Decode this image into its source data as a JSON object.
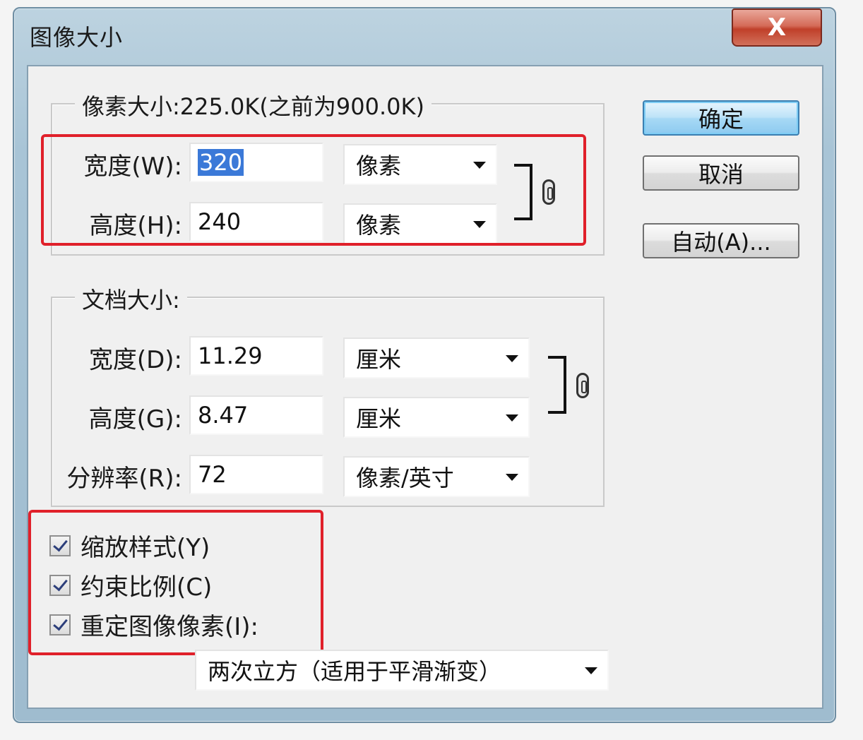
{
  "window": {
    "title": "图像大小",
    "close_glyph": "X"
  },
  "pixel_dimensions": {
    "legend": "像素大小:225.0K(之前为900.0K)",
    "width_label": "宽度(W):",
    "width_value": "320",
    "width_unit": "像素",
    "height_label": "高度(H):",
    "height_value": "240",
    "height_unit": "像素"
  },
  "document_size": {
    "legend": "文档大小:",
    "width_label": "宽度(D):",
    "width_value": "11.29",
    "width_unit": "厘米",
    "height_label": "高度(G):",
    "height_value": "8.47",
    "height_unit": "厘米",
    "resolution_label": "分辨率(R):",
    "resolution_value": "72",
    "resolution_unit": "像素/英寸"
  },
  "options": {
    "scale_styles": {
      "label": "缩放样式(Y)",
      "checked": true
    },
    "constrain_proportions": {
      "label": "约束比例(C)",
      "checked": true
    },
    "resample_image": {
      "label": "重定图像像素(I):",
      "checked": true
    },
    "resample_method": "两次立方（适用于平滑渐变）"
  },
  "buttons": {
    "ok": "确定",
    "cancel": "取消",
    "auto": "自动(A)..."
  },
  "colors": {
    "highlight": "#e0202a",
    "selection": "#3b79d8",
    "default_button": "#a7d9f5"
  }
}
